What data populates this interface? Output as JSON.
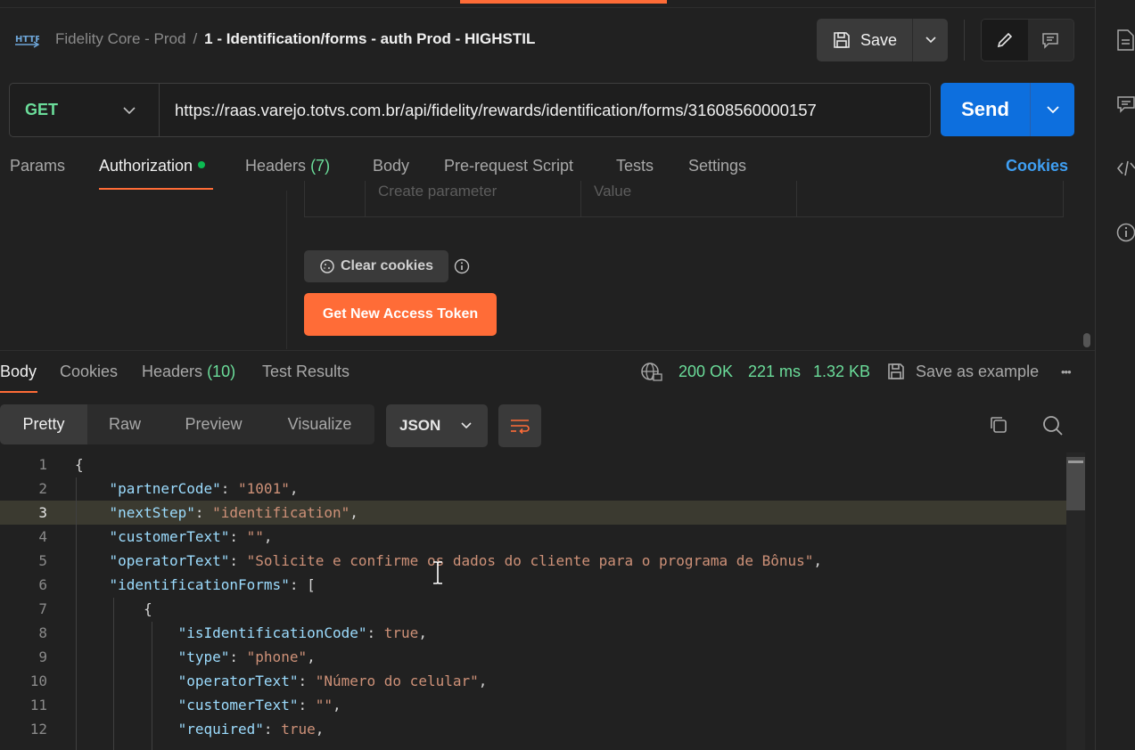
{
  "header": {
    "protocol_icon": "http-icon",
    "collection": "Fidelity Core - Prod",
    "separator": "/",
    "request_name": "1 - Identification/forms - auth Prod - HIGHSTIL",
    "save_label": "Save"
  },
  "request": {
    "method": "GET",
    "url": "https://raas.varejo.totvs.com.br/api/fidelity/rewards/identification/forms/31608560000157",
    "send_label": "Send"
  },
  "request_tabs": {
    "params": "Params",
    "authorization": "Authorization",
    "headers": "Headers",
    "headers_count": "(7)",
    "body": "Body",
    "pre_request": "Pre-request Script",
    "tests": "Tests",
    "settings": "Settings",
    "cookies": "Cookies"
  },
  "auth": {
    "param_placeholder": "Create parameter",
    "value_placeholder": "Value",
    "clear_cookies": "Clear cookies",
    "get_token": "Get New Access Token"
  },
  "response_tabs": {
    "body": "Body",
    "cookies": "Cookies",
    "headers": "Headers",
    "headers_count": "(10)",
    "test_results": "Test Results"
  },
  "response_status": {
    "status": "200 OK",
    "time": "221 ms",
    "size": "1.32 KB",
    "save_example": "Save as example",
    "more": "•••"
  },
  "view_modes": {
    "pretty": "Pretty",
    "raw": "Raw",
    "preview": "Preview",
    "visualize": "Visualize",
    "format": "JSON"
  },
  "code_lines": [
    {
      "n": "1",
      "html": "{"
    },
    {
      "n": "2",
      "html": "    <span class='k'>\"partnerCode\"</span>: <span class='s'>\"1001\"</span>,"
    },
    {
      "n": "3",
      "html": "    <span class='k'>\"nextStep\"</span>: <span class='s'>\"identification\"</span>,"
    },
    {
      "n": "4",
      "html": "    <span class='k'>\"customerText\"</span>: <span class='s'>\"\"</span>,"
    },
    {
      "n": "5",
      "html": "    <span class='k'>\"operatorText\"</span>: <span class='s'>\"Solicite e confirme os dados do cliente para o programa de Bônus\"</span>,"
    },
    {
      "n": "6",
      "html": "    <span class='k'>\"identificationForms\"</span>: ["
    },
    {
      "n": "7",
      "html": "        {"
    },
    {
      "n": "8",
      "html": "            <span class='k'>\"isIdentificationCode\"</span>: <span class='b'>true</span>,"
    },
    {
      "n": "9",
      "html": "            <span class='k'>\"type\"</span>: <span class='s'>\"phone\"</span>,"
    },
    {
      "n": "10",
      "html": "            <span class='k'>\"operatorText\"</span>: <span class='s'>\"Número do celular\"</span>,"
    },
    {
      "n": "11",
      "html": "            <span class='k'>\"customerText\"</span>: <span class='s'>\"\"</span>,"
    },
    {
      "n": "12",
      "html": "            <span class='k'>\"required\"</span>: <span class='b'>true</span>,"
    }
  ],
  "highlighted_line": "3",
  "colors": {
    "accent": "#ff6c37",
    "send": "#0d6fde",
    "method_get": "#6bdd9a",
    "status_ok": "#6bdd9a",
    "link": "#3f9ff3"
  }
}
